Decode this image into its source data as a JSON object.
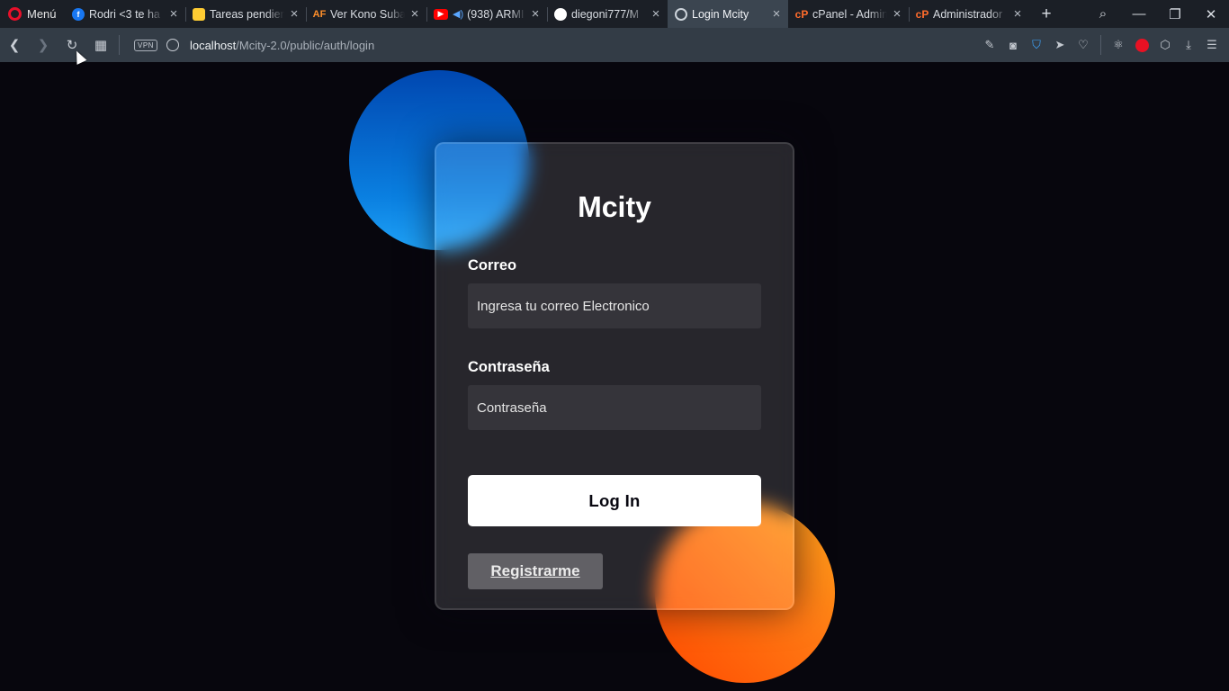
{
  "browser": {
    "menu_label": "Menú",
    "tabs": [
      {
        "title": "Rodri <3 te ha",
        "favicon": "facebook-icon"
      },
      {
        "title": "Tareas pendien",
        "favicon": "tareas-icon"
      },
      {
        "title": "Ver Kono Suba",
        "favicon": "animeflv-icon",
        "favicon_text": "AF"
      },
      {
        "title": "(938) ARMI",
        "favicon": "youtube-icon",
        "audio": "speaker-icon"
      },
      {
        "title": "diegoni777/M",
        "favicon": "github-icon"
      },
      {
        "title": "Login Mcity",
        "favicon": "globe-icon",
        "active": true
      },
      {
        "title": "cPanel - Admin",
        "favicon": "cpanel-icon",
        "favicon_text": "cP"
      },
      {
        "title": "Administrador",
        "favicon": "cpanel-icon",
        "favicon_text": "cP"
      }
    ],
    "new_tab_symbol": "+",
    "close_symbol": "×",
    "address": {
      "vpn_label": "VPN",
      "url_host": "localhost",
      "url_path": "/Mcity-2.0/public/auth/login"
    },
    "colors": {
      "tabstrip": "#1b1f26",
      "active_tab": "#3b4550",
      "toolbar": "#333c46"
    }
  },
  "page": {
    "title": "Mcity",
    "email": {
      "label": "Correo",
      "placeholder": "Ingresa tu correo Electronico"
    },
    "password": {
      "label": "Contraseña",
      "placeholder": "Contraseña"
    },
    "login_button": "Log In",
    "register_button": "Registrarme",
    "colors": {
      "background": "#07060d",
      "blue_circle": "#0a7fe0",
      "orange_circle": "#ff7a14"
    }
  }
}
